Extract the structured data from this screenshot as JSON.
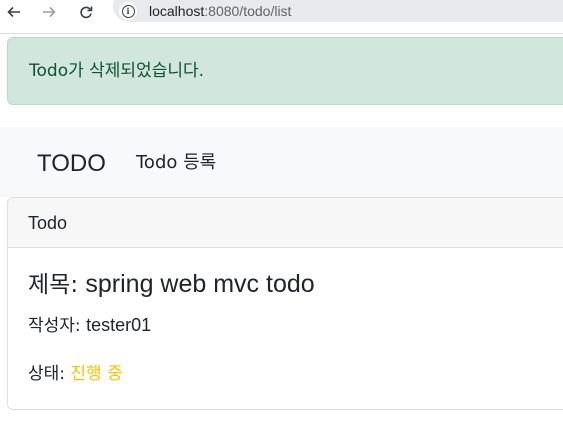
{
  "browser": {
    "back_icon": "arrow-left-icon",
    "forward_icon": "arrow-right-icon",
    "reload_icon": "reload-icon",
    "info_icon": "info-icon",
    "url_host": "localhost",
    "url_rest": ":8080/todo/list"
  },
  "alert": {
    "message": "Todo가 삭제되었습니다.",
    "color": "#d1e7dd"
  },
  "navbar": {
    "brand": "TODO",
    "link": "Todo 등록"
  },
  "card": {
    "header": "Todo",
    "title_label": "제목: ",
    "title_value": "spring web mvc todo",
    "writer_label": "작성자: ",
    "writer_value": "tester01",
    "status_label": "상태: ",
    "status_value": "진행 중",
    "status_color": "#ffc107"
  }
}
